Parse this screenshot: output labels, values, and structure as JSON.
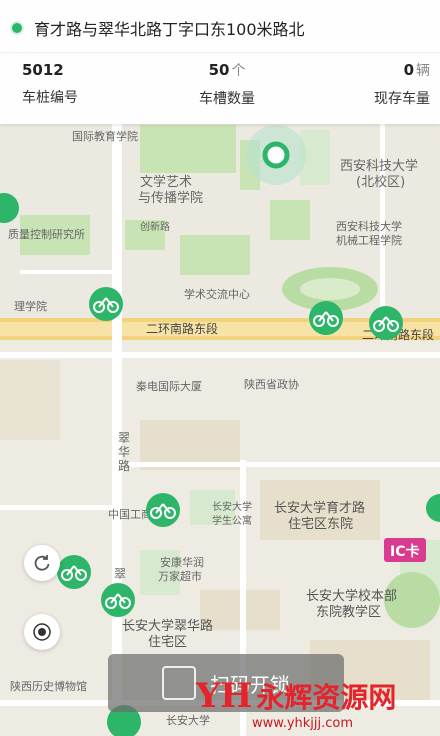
{
  "station": {
    "address": "育才路与翠华北路丁字口东100米路北",
    "stats": [
      {
        "value": "5012",
        "unit": "",
        "label": "车桩编号"
      },
      {
        "value": "50",
        "unit": "个",
        "label": "车槽数量"
      },
      {
        "value": "0",
        "unit": "辆",
        "label": "现存车量"
      }
    ]
  },
  "map": {
    "labels": {
      "intl_edu": "国际教育学院",
      "arts": "文学艺术",
      "comm": "与传播学院",
      "xust": "西安科技大学",
      "xust_north": "(北校区)",
      "xust2": "西安科技大学",
      "mech": "机械工程学院",
      "quality": "质量控制研究所",
      "innov": "创新路",
      "academic": "学术交流中心",
      "sci": "理学院",
      "road": "二环南路东段",
      "road2": "二环南路东段",
      "qindian": "秦电国际大厦",
      "shaanxi": "陕西省政协",
      "cuihua": "翠",
      "cuihua2": "华",
      "cuihua3": "路",
      "cuihua4": "翠",
      "icbc": "中国工商",
      "dorm1": "长安大学",
      "dorm2": "学生公寓",
      "yucai": "长安大学育才路",
      "yucai2": "住宅区东院",
      "anakang": "安康华润",
      "wanjia": "万家超市",
      "benbu": "长安大学校本部",
      "benbu2": "东院教学区",
      "cuihua_res": "长安大学翠华路",
      "cuihua_res2": "住宅区",
      "museum": "陕西历史博物馆",
      "chd_bottom": "长安大学",
      "ic": "IC卡"
    }
  },
  "unlock_label": "扫码开锁",
  "watermark": {
    "logo": "YH",
    "name": "永辉资源网",
    "url": "www.yhkjjj.com"
  },
  "colors": {
    "accent": "#2db56a",
    "road": "#f2d27a"
  }
}
